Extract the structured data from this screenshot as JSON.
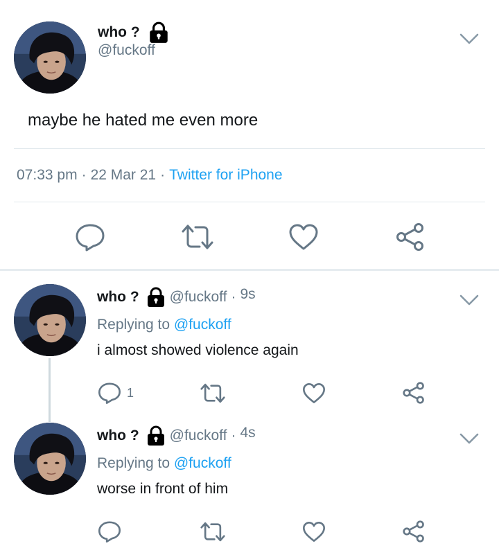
{
  "main_tweet": {
    "name": "who ?",
    "handle": "@fuckoff",
    "text": "maybe he hated me even more",
    "time": "07:33 pm",
    "date": "22 Mar 21",
    "separator": "·",
    "source": "Twitter for iPhone"
  },
  "replies": [
    {
      "name": "who ?",
      "handle": "@fuckoff",
      "dot": "·",
      "time": "9s",
      "replying_prefix": "Replying to",
      "replying_to": "@fuckoff",
      "text": "i almost showed violence again",
      "reply_count": "1"
    },
    {
      "name": "who ?",
      "handle": "@fuckoff",
      "dot": "·",
      "time": "4s",
      "replying_prefix": "Replying to",
      "replying_to": "@fuckoff",
      "text": "worse in front of him"
    }
  ],
  "colors": {
    "text": "#14171a",
    "secondary": "#657786",
    "link": "#1da1f2",
    "divider": "#e1e8ed",
    "icon": "#657786",
    "lock": "#000000"
  },
  "icons": [
    "lock-icon",
    "chevron-down-icon",
    "reply-icon",
    "retweet-icon",
    "like-icon",
    "share-icon"
  ]
}
